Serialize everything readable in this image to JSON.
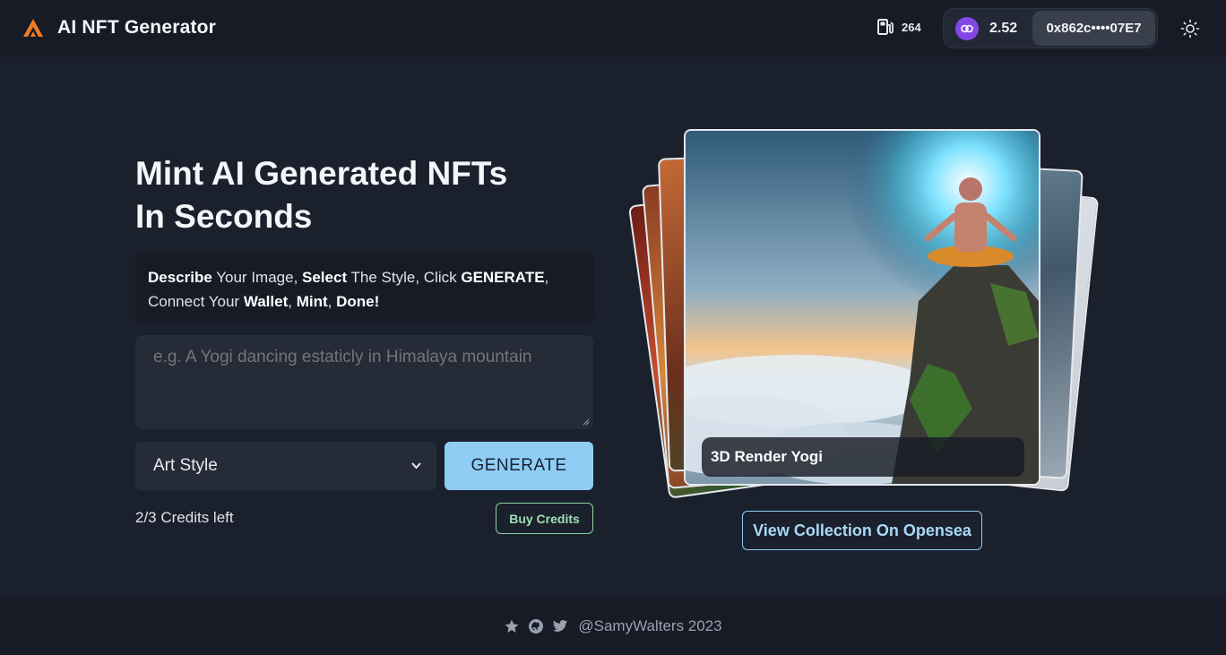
{
  "header": {
    "brand_name": "AI NFT Generator",
    "gas_value": "264",
    "balance": "2.52",
    "address": "0x862c••••07E7",
    "accent": "#8247e5"
  },
  "hero": {
    "headline_line1": "Mint AI Generated NFTs",
    "headline_line2": "In Seconds",
    "desc": {
      "describe": "Describe",
      "your_image": " Your Image, ",
      "select": "Select",
      "the_style": " The Style, Click ",
      "generate": "GENERATE",
      "comma1": ",",
      "connect_your": "Connect Your ",
      "wallet": "Wallet",
      "comma2": ", ",
      "mint": "Mint",
      "comma3": ", ",
      "done": "Done!"
    },
    "prompt_placeholder": "e.g. A Yogi dancing estaticly in Himalaya mountain",
    "art_style_label": "Art Style",
    "generate_label": "GENERATE",
    "credits_text": "2/3 Credits left",
    "buy_credits_label": "Buy Credits"
  },
  "gallery": {
    "caption": "3D Render Yogi",
    "opensea_label": "View Collection On Opensea"
  },
  "footer": {
    "text": "@SamyWalters 2023",
    "icons": [
      "star-icon",
      "github-icon",
      "twitter-icon"
    ]
  }
}
